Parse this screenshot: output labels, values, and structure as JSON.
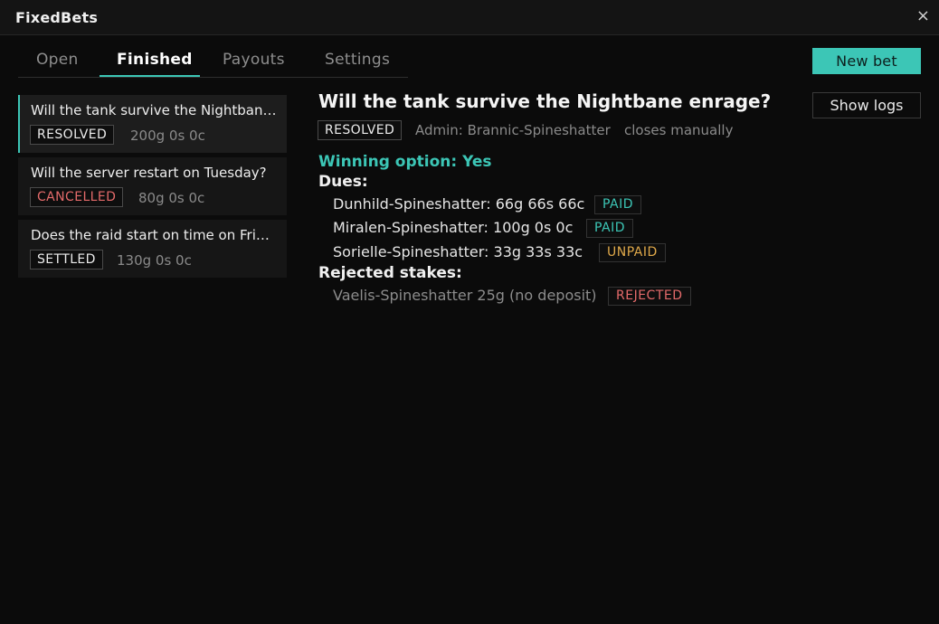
{
  "app": {
    "title": "FixedBets",
    "close_glyph": "×"
  },
  "tabs": [
    {
      "label": "Open"
    },
    {
      "label": "Finished"
    },
    {
      "label": "Payouts"
    },
    {
      "label": "Settings"
    }
  ],
  "active_tab": "Finished",
  "actions": {
    "new_bet": "New bet",
    "show_logs": "Show logs"
  },
  "bets": [
    {
      "question": "Will the tank survive the Nightbane enrage?",
      "status": "RESOLVED",
      "amount": "200g 0s 0c",
      "selected": true
    },
    {
      "question": "Will the server restart on Tuesday?",
      "status": "CANCELLED",
      "amount": "80g 0s 0c",
      "selected": false
    },
    {
      "question": "Does the raid start on time on Friday?",
      "status": "SETTLED",
      "amount": "130g 0s 0c",
      "selected": false
    }
  ],
  "detail": {
    "title": "Will the tank survive the Nightbane enrage?",
    "status": "RESOLVED",
    "admin": "Admin: Brannic-Spineshatter",
    "closes": "closes manually",
    "winning": "Winning option: Yes",
    "dues_label": "Dues:",
    "dues": [
      {
        "text": "Dunhild-Spineshatter: 66g 66s 66c",
        "status": "PAID"
      },
      {
        "text": "Miralen-Spineshatter: 100g 0s 0c",
        "status": "PAID"
      },
      {
        "text": "Sorielle-Spineshatter: 33g 33s 33c",
        "status": "UNPAID"
      }
    ],
    "rejected_label": "Rejected stakes:",
    "rejected": [
      {
        "text": "Vaelis-Spineshatter 25g (no deposit)",
        "status": "REJECTED"
      }
    ]
  },
  "colors": {
    "accent": "#3cc6b6",
    "danger": "#e36a6a",
    "warning": "#e0a94a",
    "background": "#0b0b0b"
  }
}
